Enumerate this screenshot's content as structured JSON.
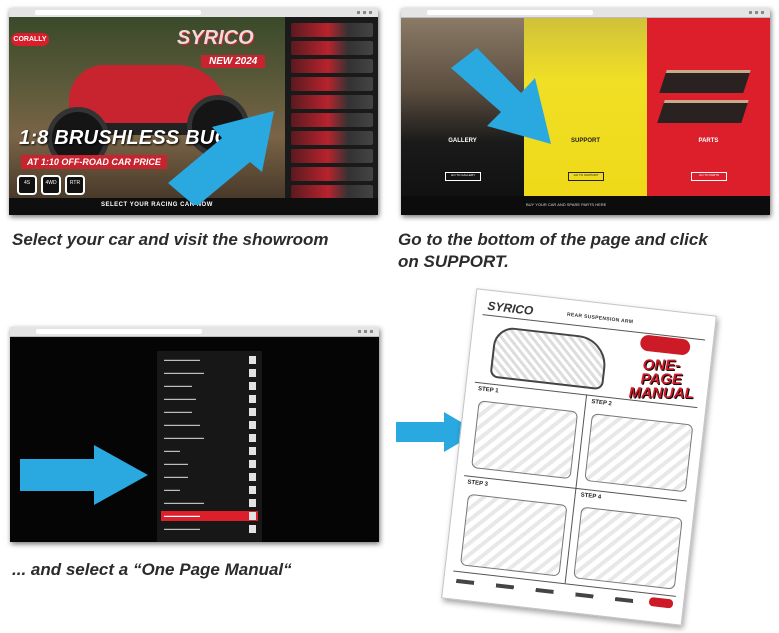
{
  "captions": {
    "step1": "Select your car and visit the showroom",
    "step2_line1": "Go to the bottom of the page and click",
    "step2_line2": "on SUPPORT.",
    "step3": "... and select a “One Page Manual“"
  },
  "colors": {
    "arrow": "#2aa8e0",
    "brand_red": "#d81e2a",
    "support_yellow": "#f0df25"
  },
  "showroom": {
    "brand": "SYRICO",
    "badge": "NEW 2024",
    "headline": "1:8 BRUSHLESS BUGGY",
    "price_tag": "AT 1:10 OFF-ROAD CAR PRICE",
    "feature_badges": [
      "4S",
      "4WD",
      "RTR"
    ],
    "cta": "SELECT YOUR RACING CAR NOW"
  },
  "support_page": {
    "sections": [
      {
        "label": "GALLERY",
        "button": "GO TO GALLERY"
      },
      {
        "label": "SUPPORT",
        "button": "GO TO SUPPORT"
      },
      {
        "label": "PARTS",
        "button": "GO TO PARTS"
      }
    ],
    "footer": "BUY YOUR CAR AND SPARE PARTS HERE"
  },
  "manual_list": {
    "selected_index": 12
  },
  "manual_page": {
    "brand": "SYRICO",
    "title": "REAR SUSPENSION ARM",
    "stamp_line1": "ONE-PAGE",
    "stamp_line2": "MANUAL",
    "steps": [
      "STEP 1",
      "STEP 2",
      "STEP 3",
      "STEP 4"
    ]
  }
}
